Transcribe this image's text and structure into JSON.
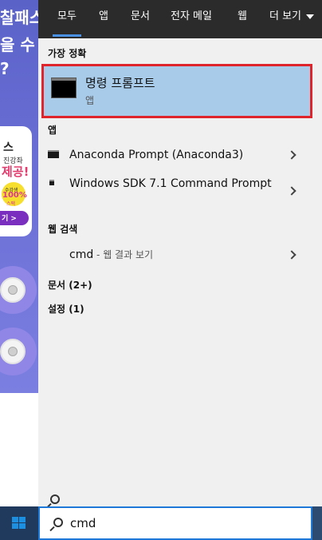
{
  "background": {
    "lines": [
      "찰패스",
      "을 수",
      "?"
    ],
    "card": {
      "title": "스",
      "subtitle": "진강좌",
      "highlight": "제공!",
      "coupon_top": "수강생",
      "coupon_big": "100%",
      "coupon_bottom": "스팩",
      "pill": "기 >"
    }
  },
  "tabs": [
    {
      "label": "모두",
      "active": true
    },
    {
      "label": "앱"
    },
    {
      "label": "문서"
    },
    {
      "label": "전자 메일"
    },
    {
      "label": "웹"
    },
    {
      "label": "더 보기"
    }
  ],
  "sections": {
    "best_match": "가장 정확",
    "apps": "앱",
    "web_search": "웹 검색",
    "documents": "문서",
    "documents_count": "(2+)",
    "settings": "설정",
    "settings_count": "(1)"
  },
  "best_match": {
    "title": "명령 프롬프트",
    "subtitle": "앱",
    "highlight_color": "#e0242c"
  },
  "apps": [
    {
      "label": "Anaconda Prompt (Anaconda3)"
    },
    {
      "label": "Windows SDK 7.1 Command Prompt"
    }
  ],
  "web": {
    "query": "cmd",
    "separator": " - ",
    "suffix": "웹 결과 보기"
  },
  "search_box": {
    "value": "cmd"
  },
  "colors": {
    "accent": "#1e78d7",
    "selected_bg": "#a8cbea",
    "topbar": "#2b2b2b",
    "taskbar": "#1f3a5c"
  }
}
